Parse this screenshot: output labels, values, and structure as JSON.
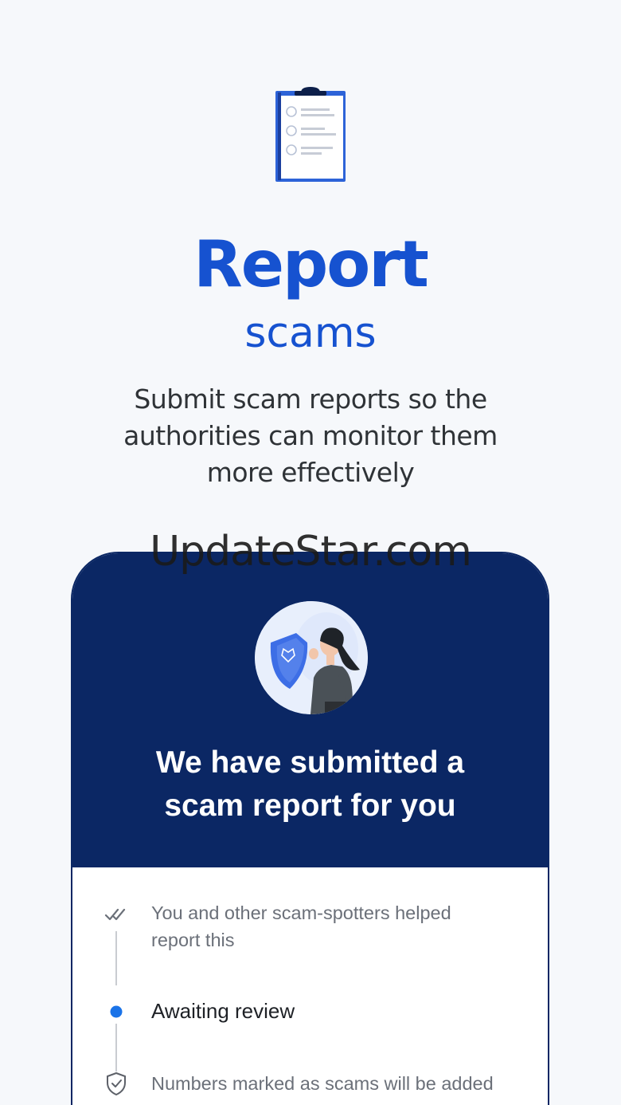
{
  "hero": {
    "icon": "clipboard-checklist-icon",
    "title": "Report",
    "subtitle": "scams",
    "description": "Submit scam reports so the authorities can monitor them more effectively"
  },
  "card": {
    "avatar": "woman-with-shield-illustration",
    "title_line1": "We have submitted a",
    "title_line2": "scam report for you",
    "steps": [
      {
        "icon": "double-check-icon",
        "text_line1": "You and other scam-spotters helped",
        "text_line2": "report this"
      },
      {
        "icon": "blue-dot-icon",
        "text_line1": "Awaiting review"
      },
      {
        "icon": "shield-check-icon",
        "text_line1": "Numbers marked as scams will be added"
      }
    ]
  },
  "watermark": "UpdateStar.com",
  "colors": {
    "accent": "#1652d0",
    "card_header": "#0b2764",
    "background": "#f6f8fb",
    "active_dot": "#1a73e8"
  }
}
